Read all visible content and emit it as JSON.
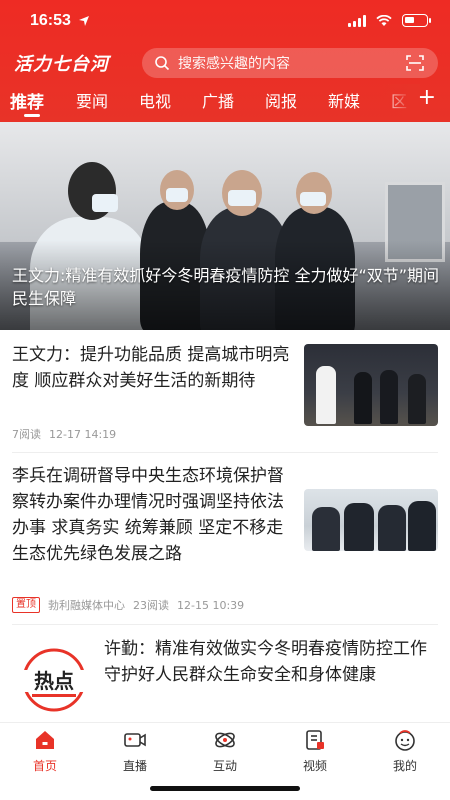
{
  "status_bar": {
    "time": "16:53"
  },
  "app": {
    "logo_text": "活力七台河",
    "accent": "#e83328"
  },
  "search": {
    "placeholder": "搜索感兴趣的内容"
  },
  "tabs": [
    {
      "label": "推荐",
      "active": true
    },
    {
      "label": "要闻"
    },
    {
      "label": "电视"
    },
    {
      "label": "广播"
    },
    {
      "label": "阅报"
    },
    {
      "label": "新媒"
    },
    {
      "label": "区"
    }
  ],
  "hero": {
    "caption": "王文力:精准有效抓好今冬明春疫情防控 全力做好“双节”期间民生保障"
  },
  "articles": [
    {
      "title": "王文力：提升功能品质 提高城市明亮度 顺应群众对美好生活的新期待",
      "reads": "7阅读",
      "time": "12-17 14:19"
    },
    {
      "title": "李兵在调研督导中央生态环境保护督察转办案件办理情况时强调坚持依法办事 求真务实 统筹兼顾 坚定不移走生态优先绿色发展之路",
      "badge": "置顶",
      "source": "勃利融媒体中心",
      "reads": "23阅读",
      "time": "12-15 10:39"
    },
    {
      "title": "许勤：精准有效做实今冬明春疫情防控工作 守护好人民群众生命安全和身体健康",
      "icon_text": "热点"
    }
  ],
  "bottom_nav": [
    {
      "label": "首页",
      "icon": "home-icon",
      "active": true
    },
    {
      "label": "直播",
      "icon": "live-camera-icon"
    },
    {
      "label": "互动",
      "icon": "interaction-icon"
    },
    {
      "label": "视频",
      "icon": "video-icon"
    },
    {
      "label": "我的",
      "icon": "profile-icon"
    }
  ]
}
